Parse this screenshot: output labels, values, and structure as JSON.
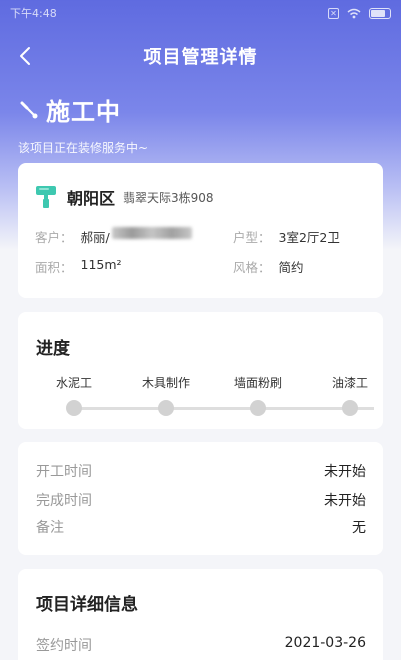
{
  "statusbar": {
    "time": "下午4:48"
  },
  "navbar": {
    "title": "项目管理详情"
  },
  "status": {
    "title": "施工中",
    "subtitle": "该项目正在装修服务中~"
  },
  "project": {
    "district": "朝阳区",
    "community": "翡翠天际3栋908",
    "customer_label": "客户：",
    "customer_value": "郝丽/",
    "layout_label": "户型：",
    "layout_value": "3室2厅2卫",
    "area_label": "面积：",
    "area_value": "115m²",
    "style_label": "风格：",
    "style_value": "简约"
  },
  "progress": {
    "title": "进度",
    "steps": [
      "水泥工",
      "木具制作",
      "墙面粉刷",
      "油漆工"
    ]
  },
  "schedule": {
    "start_label": "开工时间",
    "start_value": "未开始",
    "finish_label": "完成时间",
    "finish_value": "未开始",
    "remark_label": "备注",
    "remark_value": "无"
  },
  "details": {
    "title": "项目详细信息",
    "sign_label": "签约时间",
    "sign_value": "2021-03-26"
  },
  "colors": {
    "header": "#5f6be0",
    "brush": "#3ec8b0"
  }
}
